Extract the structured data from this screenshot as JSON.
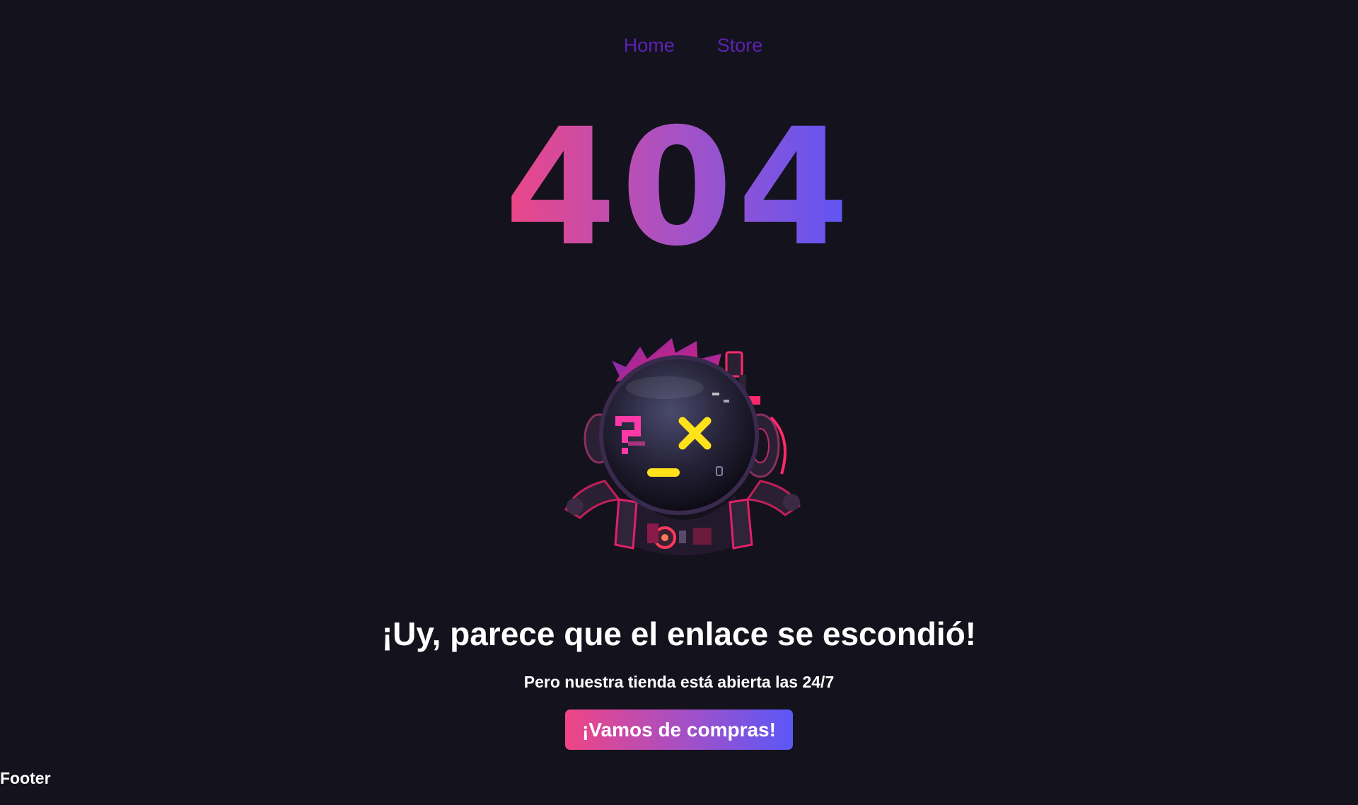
{
  "nav": {
    "items": [
      {
        "label": "Home"
      },
      {
        "label": "Store"
      }
    ]
  },
  "error": {
    "code": "404"
  },
  "message": {
    "headline": "¡Uy, parece que el enlace se escondió!",
    "subline": "Pero nuestra tienda está abierta las 24/7"
  },
  "cta": {
    "label": "¡Vamos de compras!"
  },
  "footer": {
    "label": "Footer"
  },
  "illustration": {
    "icon": "confused-robot-icon"
  },
  "colors": {
    "background": "#14121c",
    "nav_link": "#5b21b6",
    "gradient_start": "#ee4685",
    "gradient_mid": "#a652c6",
    "gradient_end": "#5b55f6"
  }
}
